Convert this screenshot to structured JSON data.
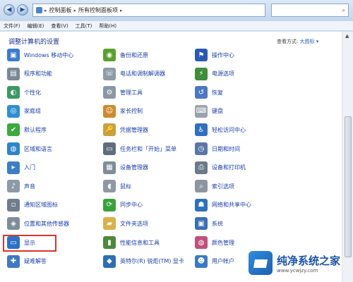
{
  "addressbar": {
    "crumbs": [
      "控制面板",
      "所有控制面板项"
    ]
  },
  "menubar": {
    "items": [
      "文件(F)",
      "编辑(E)",
      "查看(V)",
      "工具(T)",
      "帮助(H)"
    ]
  },
  "content": {
    "title": "调整计算机的设置",
    "view_by_label": "查看方式:",
    "view_by_value": "大图标 ▾"
  },
  "items": [
    {
      "label": "Windows 移动中心",
      "icon": "mobility-center-icon",
      "color": "#3a7bd5"
    },
    {
      "label": "备份和还原",
      "icon": "backup-restore-icon",
      "color": "#5aa02c"
    },
    {
      "label": "操作中心",
      "icon": "action-center-flag-icon",
      "color": "#2a5ab8"
    },
    {
      "label": "程序和功能",
      "icon": "programs-features-icon",
      "color": "#7a8896"
    },
    {
      "label": "电话和调制解调器",
      "icon": "phone-modem-icon",
      "color": "#8f9aa6"
    },
    {
      "label": "电源选项",
      "icon": "power-options-icon",
      "color": "#3f8e3a"
    },
    {
      "label": "个性化",
      "icon": "personalization-icon",
      "color": "#3b9a63"
    },
    {
      "label": "管理工具",
      "icon": "admin-tools-icon",
      "color": "#8a97a5"
    },
    {
      "label": "恢复",
      "icon": "recovery-icon",
      "color": "#4a78c2"
    },
    {
      "label": "家庭组",
      "icon": "homegroup-icon",
      "color": "#2f8fd0"
    },
    {
      "label": "家长控制",
      "icon": "parental-controls-icon",
      "color": "#d08a2a"
    },
    {
      "label": "键盘",
      "icon": "keyboard-icon",
      "color": "#9aa3ad"
    },
    {
      "label": "默认程序",
      "icon": "default-programs-icon",
      "color": "#3caa3c"
    },
    {
      "label": "凭据管理器",
      "icon": "credential-manager-icon",
      "color": "#c9a042"
    },
    {
      "label": "轻松访问中心",
      "icon": "ease-of-access-icon",
      "color": "#2f6fbf"
    },
    {
      "label": "区域和语言",
      "icon": "region-language-icon",
      "color": "#2c86c9"
    },
    {
      "label": "任务栏和「开始」菜单",
      "icon": "taskbar-start-icon",
      "color": "#5f6e7e"
    },
    {
      "label": "日期和时间",
      "icon": "date-time-icon",
      "color": "#5a76a8"
    },
    {
      "label": "入门",
      "icon": "getting-started-icon",
      "color": "#3b7fc4"
    },
    {
      "label": "设备管理器",
      "icon": "device-manager-icon",
      "color": "#7e8b99"
    },
    {
      "label": "设备和打印机",
      "icon": "devices-printers-icon",
      "color": "#6b7a8a"
    },
    {
      "label": "声音",
      "icon": "sound-icon",
      "color": "#8d9aa8"
    },
    {
      "label": "鼠标",
      "icon": "mouse-icon",
      "color": "#9099a3"
    },
    {
      "label": "索引选项",
      "icon": "indexing-options-icon",
      "color": "#8c96a1"
    },
    {
      "label": "通知区域图标",
      "icon": "notification-area-icon",
      "color": "#6f7d8c"
    },
    {
      "label": "同步中心",
      "icon": "sync-center-icon",
      "color": "#36a33a"
    },
    {
      "label": "网络和共享中心",
      "icon": "network-sharing-icon",
      "color": "#2d6fc0"
    },
    {
      "label": "位置和其他传感器",
      "icon": "location-sensors-icon",
      "color": "#7f8d9b"
    },
    {
      "label": "文件夹选项",
      "icon": "folder-options-icon",
      "color": "#d9b24a"
    },
    {
      "label": "系统",
      "icon": "system-icon",
      "color": "#3a6fb8"
    },
    {
      "label": "显示",
      "icon": "display-icon",
      "color": "#2c72c7"
    },
    {
      "label": "性能信息和工具",
      "icon": "performance-icon",
      "color": "#4a8a3b"
    },
    {
      "label": "颜色管理",
      "icon": "color-management-icon",
      "color": "#c24f7a"
    },
    {
      "label": "疑难解答",
      "icon": "troubleshooting-icon",
      "color": "#3f78c6"
    },
    {
      "label": "英特尔(R) 锐炬(TM) 显卡",
      "icon": "intel-graphics-icon",
      "color": "#2c6fb5"
    },
    {
      "label": "用户帐户",
      "icon": "user-accounts-icon",
      "color": "#3c7ac6"
    }
  ],
  "watermark": {
    "title": "纯净系统之家",
    "url": "www.ycwjzy.com"
  }
}
